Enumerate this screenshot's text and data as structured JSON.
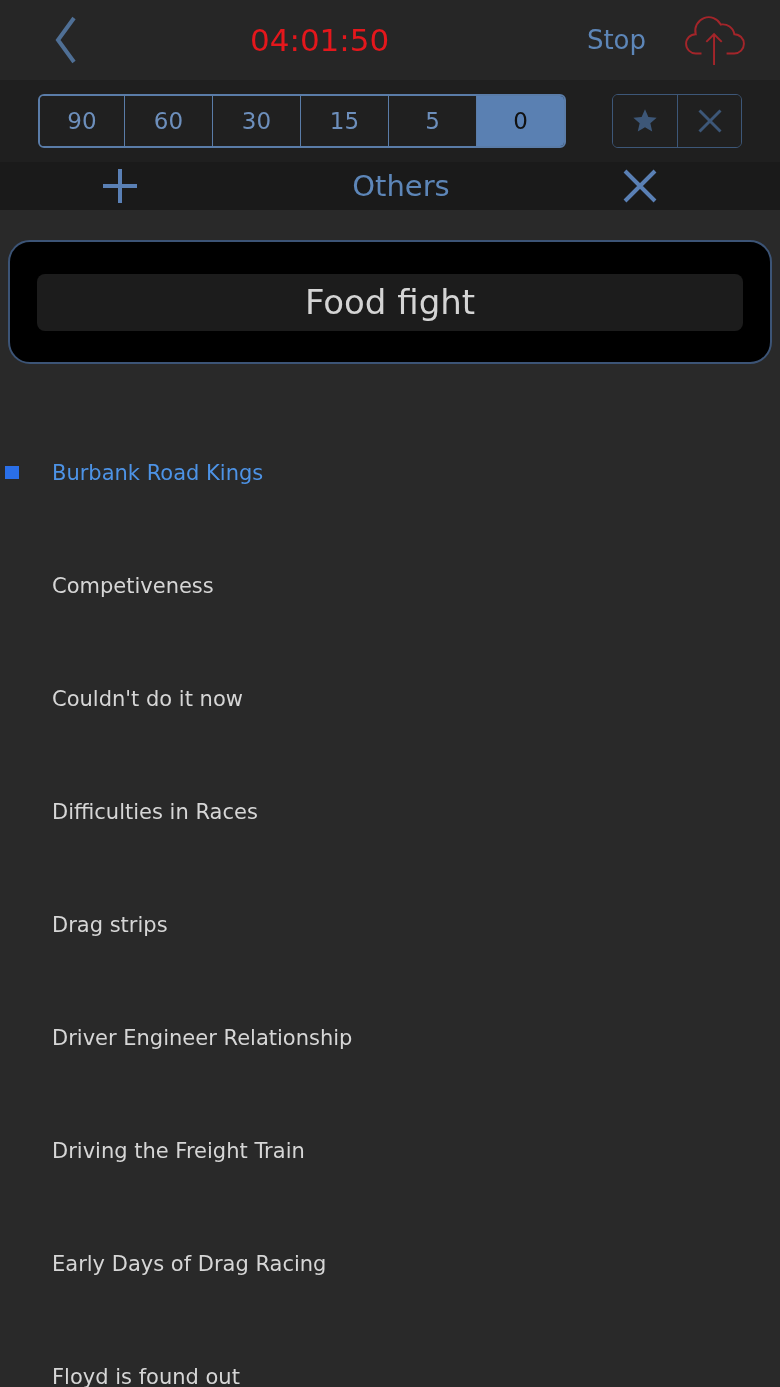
{
  "header": {
    "timer": "04:01:50",
    "stop": "Stop"
  },
  "intervals": [
    {
      "label": "90",
      "selected": false
    },
    {
      "label": "60",
      "selected": false
    },
    {
      "label": "30",
      "selected": false
    },
    {
      "label": "15",
      "selected": false
    },
    {
      "label": "5",
      "selected": false
    },
    {
      "label": "0",
      "selected": true
    }
  ],
  "category": {
    "title": "Others"
  },
  "popup": {
    "value": "Food fight"
  },
  "topics": [
    {
      "label": "Burbank Road Kings",
      "marked": true
    },
    {
      "label": "Competiveness",
      "marked": false
    },
    {
      "label": "Couldn't do it now",
      "marked": false
    },
    {
      "label": "Difficulties in Races",
      "marked": false
    },
    {
      "label": "Drag strips",
      "marked": false
    },
    {
      "label": "Driver Engineer Relationship",
      "marked": false
    },
    {
      "label": "Driving the Freight Train",
      "marked": false
    },
    {
      "label": "Early Days of Drag Racing",
      "marked": false
    },
    {
      "label": "Floyd is found out",
      "marked": false
    }
  ]
}
